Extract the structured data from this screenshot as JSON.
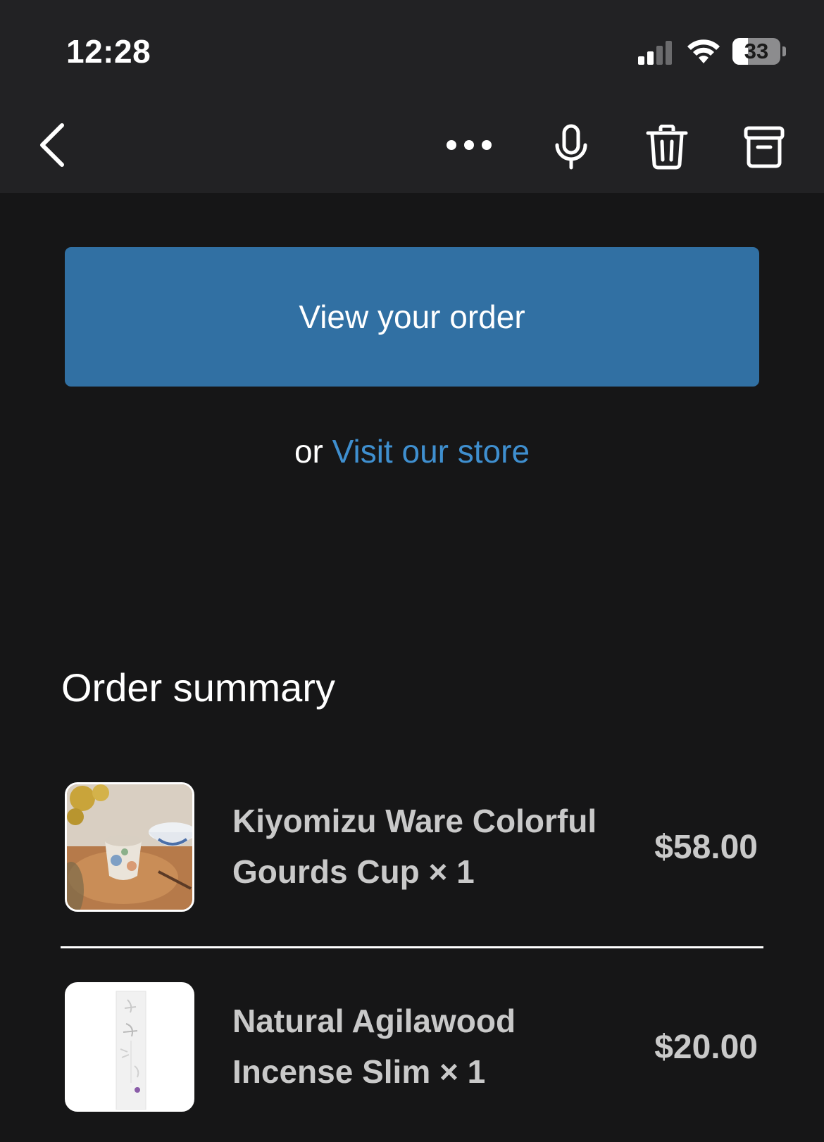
{
  "status_bar": {
    "time": "12:28",
    "battery_level": "33",
    "battery_fraction": 0.33,
    "signal_bars_active": 2,
    "signal_bars_total": 4
  },
  "toolbar": {
    "back_icon": "chevron-left-icon",
    "more_icon": "more-horizontal-icon",
    "mic_icon": "microphone-icon",
    "delete_icon": "trash-icon",
    "archive_icon": "archive-icon"
  },
  "email": {
    "cta_label": "View your order",
    "store_prefix": "or",
    "store_link": "Visit our store",
    "summary_title": "Order summary",
    "items": [
      {
        "name": "Kiyomizu Ware Colorful Gourds Cup × 1",
        "price": "$58.00",
        "thumb": "cup-photo"
      },
      {
        "name": "Natural Agilawood Incense Slim × 1",
        "price": "$20.00",
        "thumb": "incense-box-photo"
      }
    ]
  },
  "colors": {
    "background": "#161617",
    "topbar": "#222224",
    "cta": "#3170a3",
    "link": "#3f8fcf",
    "item_text": "#c9c9c9"
  }
}
